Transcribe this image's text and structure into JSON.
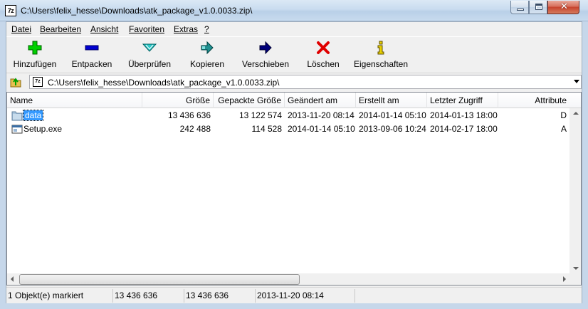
{
  "window": {
    "app_icon_text": "7z",
    "title": "C:\\Users\\felix_hesse\\Downloads\\atk_package_v1.0.0033.zip\\"
  },
  "menu": {
    "items": [
      {
        "label": "Datei"
      },
      {
        "label": "Bearbeiten"
      },
      {
        "label": "Ansicht"
      },
      {
        "label": "Favoriten"
      },
      {
        "label": "Extras"
      },
      {
        "label": "?"
      }
    ]
  },
  "toolbar": {
    "buttons": [
      {
        "label": "Hinzufügen",
        "icon": "plus-icon",
        "color": "#00c000"
      },
      {
        "label": "Entpacken",
        "icon": "minus-icon",
        "color": "#0000c0"
      },
      {
        "label": "Überprüfen",
        "icon": "checkmark-icon",
        "color": "#00b0b0"
      },
      {
        "label": "Kopieren",
        "icon": "copy-arrow-icon",
        "color": "#008080"
      },
      {
        "label": "Verschieben",
        "icon": "move-arrow-icon",
        "color": "#000080"
      },
      {
        "label": "Löschen",
        "icon": "delete-x-icon",
        "color": "#e00000"
      },
      {
        "label": "Eigenschaften",
        "icon": "info-icon",
        "color": "#c8b400"
      }
    ]
  },
  "address": {
    "path": "C:\\Users\\felix_hesse\\Downloads\\atk_package_v1.0.0033.zip\\"
  },
  "list": {
    "columns": [
      "Name",
      "Größe",
      "Gepackte Größe",
      "Geändert am",
      "Erstellt am",
      "Letzter Zugriff",
      "Attribute"
    ],
    "rows": [
      {
        "name": "data",
        "size": "13 436 636",
        "packed": "13 122 574",
        "modified": "2013-11-20 08:14",
        "created": "2014-01-14 05:10",
        "accessed": "2014-01-13 18:00",
        "attr": "D",
        "icon": "folder-icon",
        "selected": true
      },
      {
        "name": "Setup.exe",
        "size": "242 488",
        "packed": "114 528",
        "modified": "2014-01-14 05:10",
        "created": "2013-09-06 10:24",
        "accessed": "2014-02-17 18:00",
        "attr": "A",
        "icon": "exe-file-icon",
        "selected": false
      }
    ]
  },
  "status": {
    "selection": "1 Objekt(e) markiert",
    "size": "13 436 636",
    "packed_size": "13 436 636",
    "modified": "2013-11-20 08:14"
  },
  "colors": {
    "selection": "#3399ff",
    "title_gradient": "#c9dcef",
    "close_button": "#c7432d"
  }
}
